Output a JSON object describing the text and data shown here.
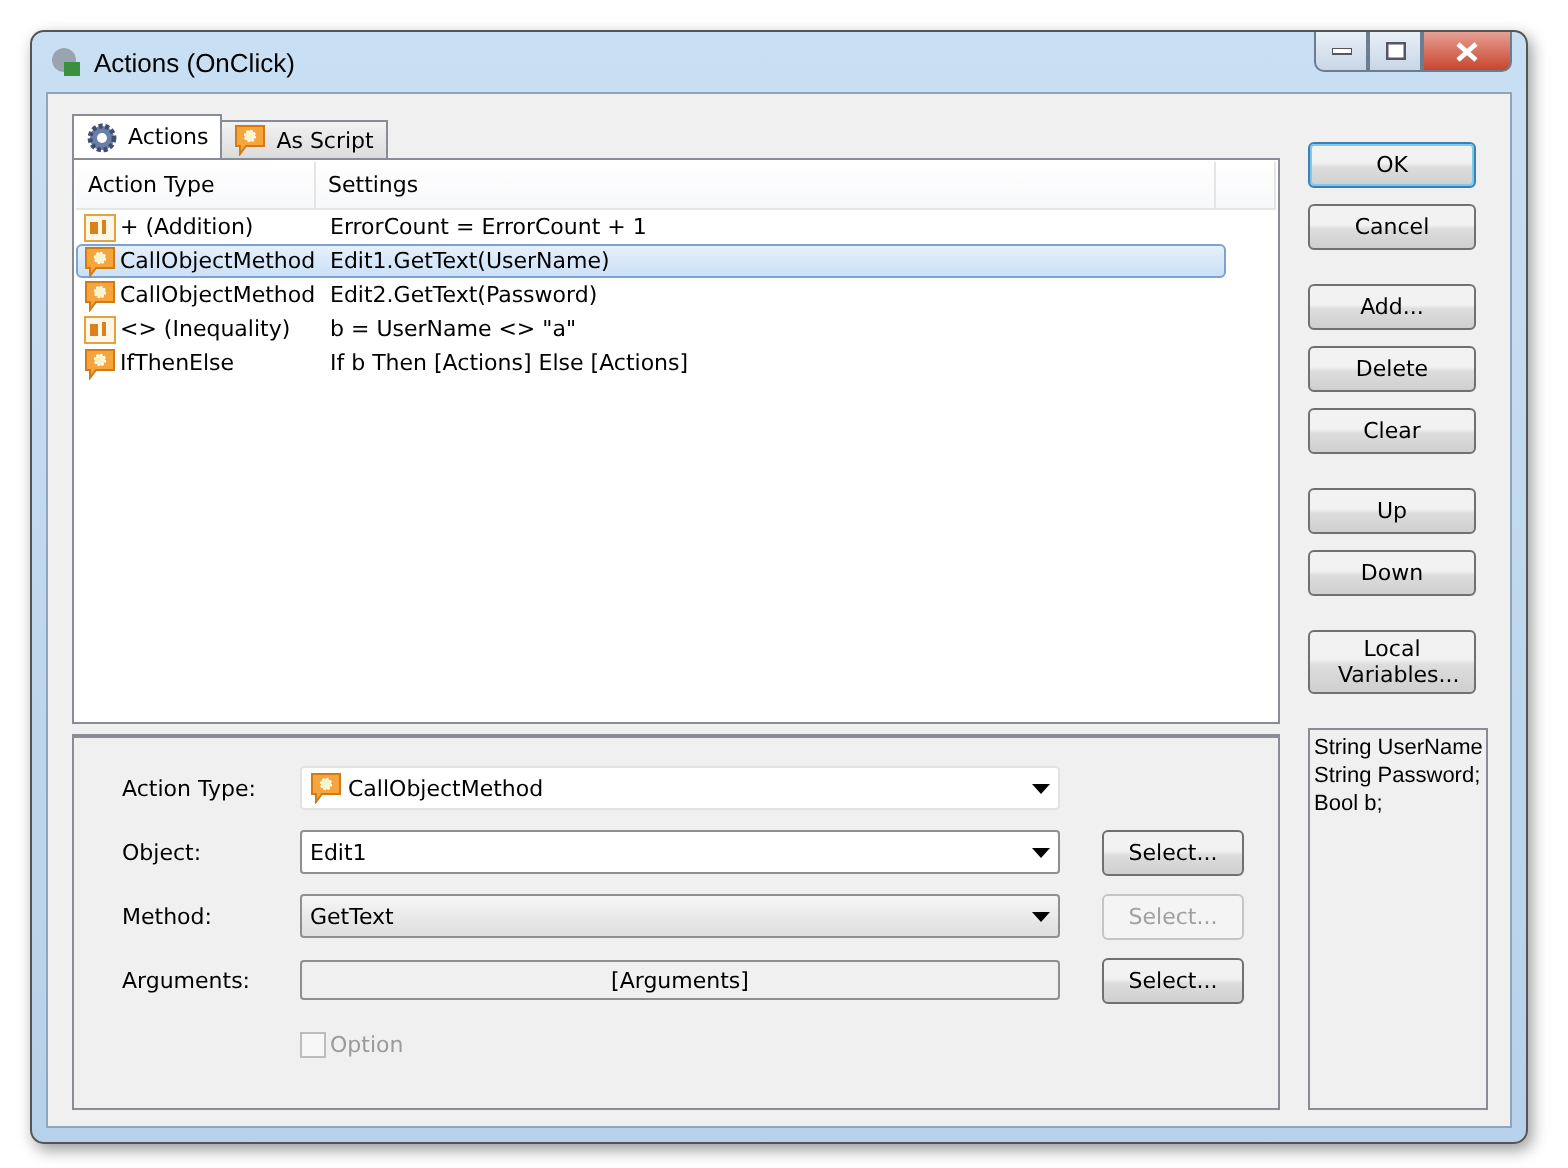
{
  "window": {
    "title": "Actions (OnClick)"
  },
  "tabs": [
    {
      "label": "Actions",
      "kind": "gear",
      "selected": true
    },
    {
      "label": "As Script",
      "kind": "method",
      "selected": false
    }
  ],
  "table": {
    "columns": [
      "Action Type",
      "Settings"
    ],
    "rows": [
      {
        "kind": "operator",
        "action_type": "+ (Addition)",
        "settings": "ErrorCount = ErrorCount + 1",
        "selected": false
      },
      {
        "kind": "method",
        "action_type": "CallObjectMethod",
        "settings": "Edit1.GetText(UserName)",
        "selected": true
      },
      {
        "kind": "method",
        "action_type": "CallObjectMethod",
        "settings": "Edit2.GetText(Password)",
        "selected": false
      },
      {
        "kind": "operator",
        "action_type": "<> (Inequality)",
        "settings": "b = UserName <> \"a\"",
        "selected": false
      },
      {
        "kind": "method",
        "action_type": "IfThenElse",
        "settings": "If b Then [Actions] Else [Actions]",
        "selected": false
      }
    ]
  },
  "form": {
    "fields": [
      {
        "label": "Action Type:",
        "kind": "dropdown",
        "value": "CallObjectMethod"
      },
      {
        "label": "Object:",
        "kind": "combo",
        "value": "Edit1",
        "select_button": {
          "label": "Select...",
          "disabled": false
        }
      },
      {
        "label": "Method:",
        "kind": "dropdown_grey",
        "value": "GetText",
        "select_button": {
          "label": "Select...",
          "disabled": true
        }
      },
      {
        "label": "Arguments:",
        "kind": "readonly",
        "value": "[Arguments]",
        "select_button": {
          "label": "Select...",
          "disabled": false
        }
      }
    ],
    "option": {
      "label": "Option",
      "checked": false,
      "disabled": true
    }
  },
  "button_groups": [
    [
      {
        "label": "OK",
        "default": true
      },
      {
        "label": "Cancel",
        "default": false
      }
    ],
    [
      {
        "label": "Add...",
        "default": false
      },
      {
        "label": "Delete",
        "default": false
      },
      {
        "label": "Clear",
        "default": false
      }
    ],
    [
      {
        "label": "Up",
        "default": false
      },
      {
        "label": "Down",
        "default": false
      }
    ],
    [
      {
        "label": "Local Variables...",
        "default": false
      }
    ]
  ],
  "local_variables": [
    "String UserName",
    "String Password;",
    "Bool b;"
  ]
}
